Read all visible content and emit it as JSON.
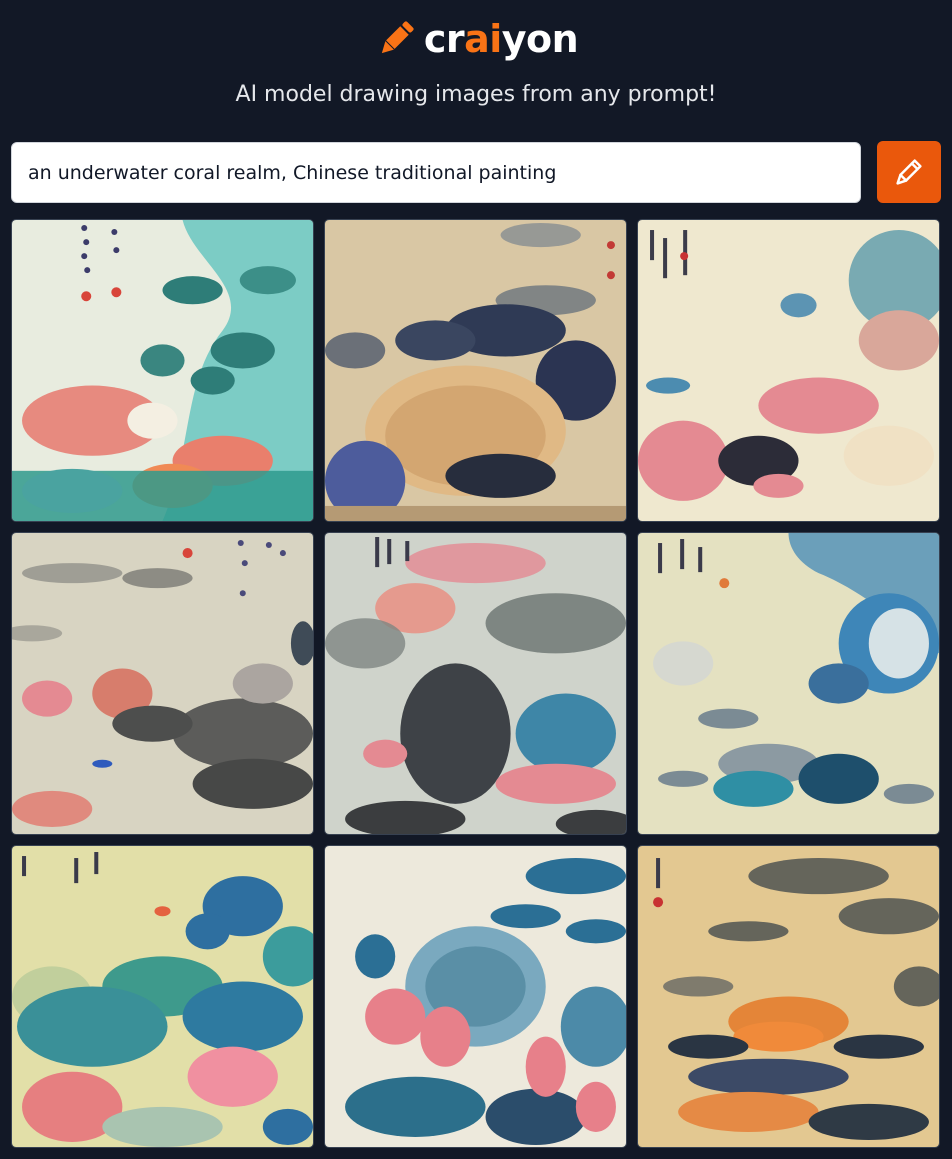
{
  "brand": {
    "name_part1": "cr",
    "name_part2": "ai",
    "name_part3": "yon",
    "logo_icon": "pencil-icon",
    "accent_color": "#f97316"
  },
  "tagline": "AI model drawing images from any prompt!",
  "prompt": {
    "value": "an underwater coral realm, Chinese traditional painting"
  },
  "draw_button": {
    "icon": "pencil-icon",
    "color": "#ea580c"
  },
  "results": {
    "count": 9,
    "images": [
      {
        "id": "result-image-1",
        "palette": "teal-coral"
      },
      {
        "id": "result-image-2",
        "palette": "beige-ink"
      },
      {
        "id": "result-image-3",
        "palette": "cream-pink"
      },
      {
        "id": "result-image-4",
        "palette": "gray-mist"
      },
      {
        "id": "result-image-5",
        "palette": "gray-pink"
      },
      {
        "id": "result-image-6",
        "palette": "olive-blue"
      },
      {
        "id": "result-image-7",
        "palette": "olive-teal"
      },
      {
        "id": "result-image-8",
        "palette": "cream-blue"
      },
      {
        "id": "result-image-9",
        "palette": "tan-ink"
      }
    ]
  }
}
